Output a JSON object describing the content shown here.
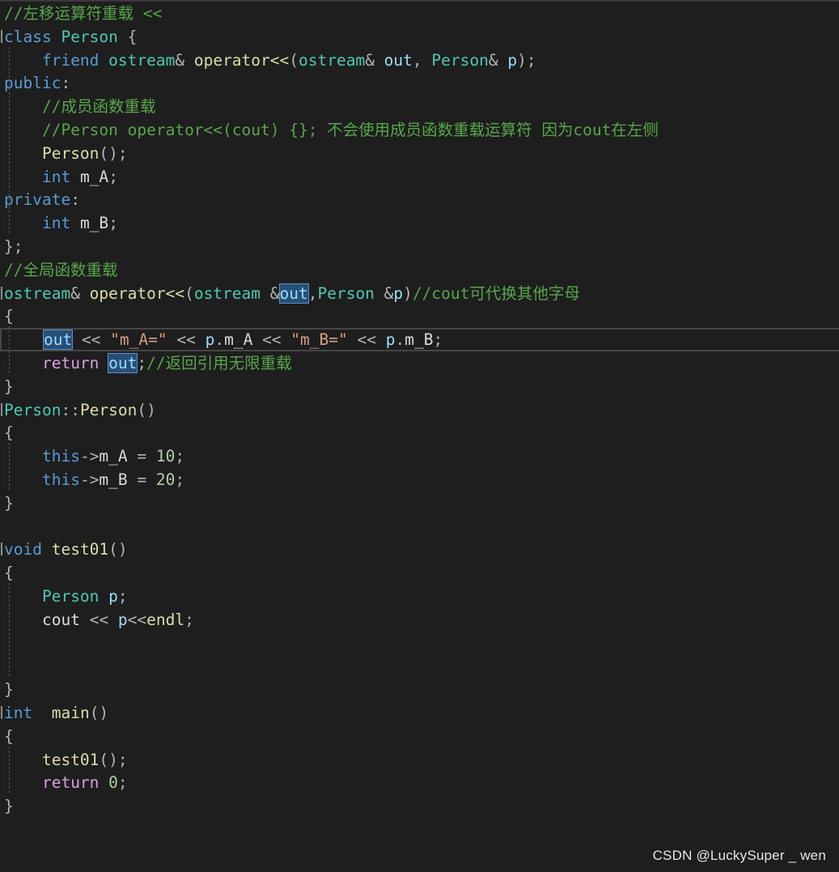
{
  "editor": {
    "lines": [
      {
        "tokens": [
          {
            "text": "//左移运算符重载 <<",
            "type": "cmt"
          }
        ]
      },
      {
        "tokens": [
          {
            "text": "class",
            "type": "kw"
          },
          {
            "text": " ",
            "type": "plain"
          },
          {
            "text": "Person",
            "type": "type"
          },
          {
            "text": " {",
            "type": "op"
          }
        ]
      },
      {
        "tokens": [
          {
            "text": "    ",
            "type": "plain"
          },
          {
            "text": "friend",
            "type": "kw"
          },
          {
            "text": " ",
            "type": "plain"
          },
          {
            "text": "ostream",
            "type": "type"
          },
          {
            "text": "& ",
            "type": "op"
          },
          {
            "text": "operator<<",
            "type": "func"
          },
          {
            "text": "(",
            "type": "op"
          },
          {
            "text": "ostream",
            "type": "type"
          },
          {
            "text": "& ",
            "type": "op"
          },
          {
            "text": "out",
            "type": "var"
          },
          {
            "text": ", ",
            "type": "op"
          },
          {
            "text": "Person",
            "type": "type"
          },
          {
            "text": "& ",
            "type": "op"
          },
          {
            "text": "p",
            "type": "var"
          },
          {
            "text": ");",
            "type": "op"
          }
        ]
      },
      {
        "tokens": [
          {
            "text": "public",
            "type": "kw"
          },
          {
            "text": ":",
            "type": "op"
          }
        ]
      },
      {
        "tokens": [
          {
            "text": "    ",
            "type": "plain"
          },
          {
            "text": "//成员函数重载",
            "type": "cmt"
          }
        ]
      },
      {
        "tokens": [
          {
            "text": "    ",
            "type": "plain"
          },
          {
            "text": "//Person operator<<(cout) {}; 不会使用成员函数重载运算符 因为cout在左侧",
            "type": "cmt"
          }
        ]
      },
      {
        "tokens": [
          {
            "text": "    ",
            "type": "plain"
          },
          {
            "text": "Person",
            "type": "func"
          },
          {
            "text": "();",
            "type": "op"
          }
        ]
      },
      {
        "tokens": [
          {
            "text": "    ",
            "type": "plain"
          },
          {
            "text": "int",
            "type": "kw"
          },
          {
            "text": " ",
            "type": "plain"
          },
          {
            "text": "m_A",
            "type": "id"
          },
          {
            "text": ";",
            "type": "op"
          }
        ]
      },
      {
        "tokens": [
          {
            "text": "private",
            "type": "kw"
          },
          {
            "text": ":",
            "type": "op"
          }
        ]
      },
      {
        "tokens": [
          {
            "text": "    ",
            "type": "plain"
          },
          {
            "text": "int",
            "type": "kw"
          },
          {
            "text": " ",
            "type": "plain"
          },
          {
            "text": "m_B",
            "type": "id"
          },
          {
            "text": ";",
            "type": "op"
          }
        ]
      },
      {
        "tokens": [
          {
            "text": "};",
            "type": "op"
          }
        ]
      },
      {
        "tokens": [
          {
            "text": "//全局函数重载",
            "type": "cmt"
          }
        ]
      },
      {
        "tokens": [
          {
            "text": "ostream",
            "type": "type"
          },
          {
            "text": "& ",
            "type": "op"
          },
          {
            "text": "operator<<",
            "type": "func"
          },
          {
            "text": "(",
            "type": "op"
          },
          {
            "text": "ostream",
            "type": "type"
          },
          {
            "text": " &",
            "type": "op"
          },
          {
            "text": "out",
            "type": "var",
            "hl": true
          },
          {
            "text": ",",
            "type": "op"
          },
          {
            "text": "Person",
            "type": "type"
          },
          {
            "text": " &",
            "type": "op"
          },
          {
            "text": "p",
            "type": "var"
          },
          {
            "text": ")",
            "type": "op"
          },
          {
            "text": "//cout可代换其他字母",
            "type": "cmt"
          }
        ]
      },
      {
        "tokens": [
          {
            "text": "{",
            "type": "op"
          }
        ]
      },
      {
        "current": true,
        "tokens": [
          {
            "text": "    ",
            "type": "plain"
          },
          {
            "text": "out",
            "type": "var",
            "hl": true
          },
          {
            "text": " << ",
            "type": "op"
          },
          {
            "text": "\"m_A=\"",
            "type": "str"
          },
          {
            "text": " << ",
            "type": "op"
          },
          {
            "text": "p",
            "type": "var"
          },
          {
            "text": ".",
            "type": "op"
          },
          {
            "text": "m_A",
            "type": "id"
          },
          {
            "text": " << ",
            "type": "op"
          },
          {
            "text": "\"m_B=\"",
            "type": "str"
          },
          {
            "text": " << ",
            "type": "op"
          },
          {
            "text": "p",
            "type": "var"
          },
          {
            "text": ".",
            "type": "op"
          },
          {
            "text": "m_B",
            "type": "id"
          },
          {
            "text": ";",
            "type": "op"
          }
        ]
      },
      {
        "tokens": [
          {
            "text": "    ",
            "type": "plain"
          },
          {
            "text": "return",
            "type": "kw2"
          },
          {
            "text": " ",
            "type": "plain"
          },
          {
            "text": "out",
            "type": "var",
            "hl": true
          },
          {
            "text": ";",
            "type": "op"
          },
          {
            "text": "//返回引用无限重载",
            "type": "cmt"
          }
        ]
      },
      {
        "tokens": [
          {
            "text": "}",
            "type": "op"
          }
        ]
      },
      {
        "tokens": [
          {
            "text": "Person",
            "type": "type"
          },
          {
            "text": "::",
            "type": "op"
          },
          {
            "text": "Person",
            "type": "func"
          },
          {
            "text": "()",
            "type": "op"
          }
        ]
      },
      {
        "tokens": [
          {
            "text": "{",
            "type": "op"
          }
        ]
      },
      {
        "tokens": [
          {
            "text": "    ",
            "type": "plain"
          },
          {
            "text": "this",
            "type": "kw"
          },
          {
            "text": "->",
            "type": "op"
          },
          {
            "text": "m_A",
            "type": "id"
          },
          {
            "text": " = ",
            "type": "op"
          },
          {
            "text": "10",
            "type": "num"
          },
          {
            "text": ";",
            "type": "op"
          }
        ]
      },
      {
        "tokens": [
          {
            "text": "    ",
            "type": "plain"
          },
          {
            "text": "this",
            "type": "kw"
          },
          {
            "text": "->",
            "type": "op"
          },
          {
            "text": "m_B",
            "type": "id"
          },
          {
            "text": " = ",
            "type": "op"
          },
          {
            "text": "20",
            "type": "num"
          },
          {
            "text": ";",
            "type": "op"
          }
        ]
      },
      {
        "tokens": [
          {
            "text": "}",
            "type": "op"
          }
        ]
      },
      {
        "tokens": []
      },
      {
        "tokens": [
          {
            "text": "void",
            "type": "kw"
          },
          {
            "text": " ",
            "type": "plain"
          },
          {
            "text": "test01",
            "type": "func"
          },
          {
            "text": "()",
            "type": "op"
          }
        ]
      },
      {
        "tokens": [
          {
            "text": "{",
            "type": "op"
          }
        ]
      },
      {
        "tokens": [
          {
            "text": "    ",
            "type": "plain"
          },
          {
            "text": "Person",
            "type": "type"
          },
          {
            "text": " ",
            "type": "plain"
          },
          {
            "text": "p",
            "type": "var"
          },
          {
            "text": ";",
            "type": "op"
          }
        ]
      },
      {
        "tokens": [
          {
            "text": "    ",
            "type": "plain"
          },
          {
            "text": "cout",
            "type": "id"
          },
          {
            "text": " << ",
            "type": "op"
          },
          {
            "text": "p",
            "type": "var"
          },
          {
            "text": "<<",
            "type": "op"
          },
          {
            "text": "endl",
            "type": "func"
          },
          {
            "text": ";",
            "type": "op"
          }
        ]
      },
      {
        "tokens": []
      },
      {
        "tokens": []
      },
      {
        "tokens": [
          {
            "text": "}",
            "type": "op"
          }
        ]
      },
      {
        "tokens": [
          {
            "text": "int",
            "type": "kw"
          },
          {
            "text": "  ",
            "type": "plain"
          },
          {
            "text": "main",
            "type": "func"
          },
          {
            "text": "()",
            "type": "op"
          }
        ]
      },
      {
        "tokens": [
          {
            "text": "{",
            "type": "op"
          }
        ]
      },
      {
        "tokens": [
          {
            "text": "    ",
            "type": "plain"
          },
          {
            "text": "test01",
            "type": "func"
          },
          {
            "text": "();",
            "type": "op"
          }
        ]
      },
      {
        "tokens": [
          {
            "text": "    ",
            "type": "plain"
          },
          {
            "text": "return",
            "type": "kw2"
          },
          {
            "text": " ",
            "type": "plain"
          },
          {
            "text": "0",
            "type": "num"
          },
          {
            "text": ";",
            "type": "op"
          }
        ]
      },
      {
        "tokens": [
          {
            "text": "}",
            "type": "op"
          }
        ]
      }
    ]
  },
  "watermark": "CSDN @LuckySuper _ wen"
}
